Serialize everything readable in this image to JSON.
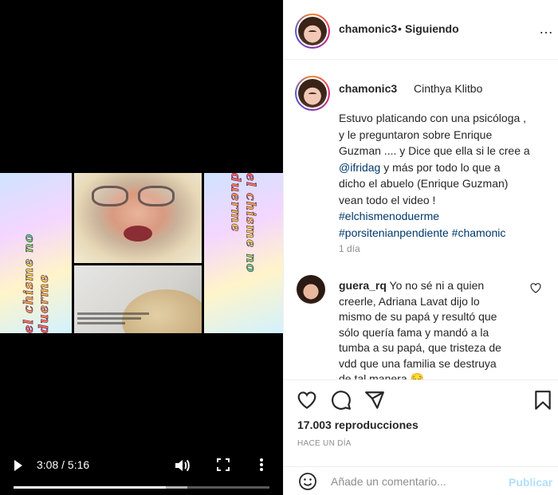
{
  "video": {
    "sticker_text": "el chisme no duerme",
    "current_time": "3:08",
    "duration": "5:16",
    "time_separator": " / ",
    "progress_fraction": 0.595,
    "buffered_fraction": 0.68
  },
  "header": {
    "username": "chamonic3",
    "separator": "•",
    "follow_status": "Siguiendo",
    "more_icon": "…"
  },
  "caption": {
    "username": "chamonic3",
    "display_name": "Cinthya Klitbo",
    "lines": [
      "Estuvo platicando con una psicóloga ,",
      " y le preguntaron sobre Enrique",
      "Guzman .... y Dice que ella si le cree a"
    ],
    "mention": "@ifridag",
    "after_mention": " y más por todo lo que a",
    "more_lines": [
      "dicho el abuelo (Enrique Guzman)",
      "vean todo el video !"
    ],
    "hashtag_1": "#elchismenoduerme",
    "hashtag_2": "#porsitenianpendiente",
    "hashtag_3": "#chamonic",
    "time_ago": "1 día"
  },
  "comment": {
    "username": "guera_rq",
    "first_line": " Yo no sé ni a quien",
    "lines": [
      "creerle, Adriana Lavat dijo lo",
      "mismo de su papá y resultó que",
      "sólo quería fama y mandó a la",
      "tumba a su papá, que tristeza de",
      "vdd que una familia se destruya",
      "de tal manera 😔"
    ]
  },
  "stats": {
    "views": "17.003 reproducciones",
    "date": "HACE UN DÍA"
  },
  "add_comment": {
    "placeholder": "Añade un comentario...",
    "post_label": "Publicar"
  },
  "colors": {
    "link": "#00376b",
    "muted": "#8e8e8e",
    "post_button_disabled": "#b2dffc",
    "border": "#efefef"
  },
  "icons": [
    "play-icon",
    "volume-icon",
    "fullscreen-icon",
    "more-options-icon",
    "heart-icon",
    "comment-icon",
    "share-icon",
    "bookmark-icon",
    "emoji-icon"
  ]
}
